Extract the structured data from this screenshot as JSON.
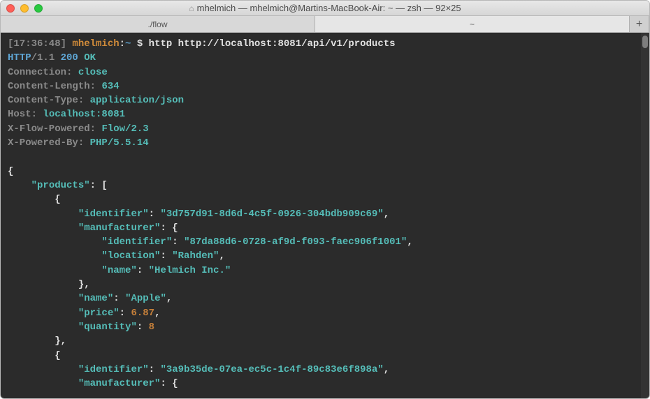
{
  "window": {
    "title": "mhelmich — mhelmich@Martins-MacBook-Air: ~ — zsh — 92×25"
  },
  "tabs": {
    "left": "./flow",
    "right": "~",
    "add": "+"
  },
  "prompt": {
    "time": "[17:36:48]",
    "user": "mhelmich",
    "sep": ":",
    "path": "~",
    "sigil": "$",
    "command": "http http://localhost:8081/api/v1/products"
  },
  "response": {
    "protocol": "HTTP",
    "slash": "/1.1",
    "status_code": "200",
    "status_text": "OK",
    "headers": {
      "connection_k": "Connection:",
      "connection_v": "close",
      "content_length_k": "Content-Length:",
      "content_length_v": "634",
      "content_type_k": "Content-Type:",
      "content_type_v": "application/json",
      "host_k": "Host:",
      "host_v": "localhost:8081",
      "x_flow_k": "X-Flow-Powered:",
      "x_flow_v": "Flow/2.3",
      "x_powered_k": "X-Powered-By:",
      "x_powered_v": "PHP/5.5.14"
    }
  },
  "json_body": {
    "open_brace": "{",
    "products_key": "\"products\"",
    "colon_bracket": ": [",
    "obj_open": "{",
    "p1_identifier_k": "\"identifier\"",
    "p1_identifier_v": "\"3d757d91-8d6d-4c5f-0926-304bdb909c69\"",
    "p1_manufacturer_k": "\"manufacturer\"",
    "m1_identifier_k": "\"identifier\"",
    "m1_identifier_v": "\"87da88d6-0728-af9d-f093-faec906f1001\"",
    "m1_location_k": "\"location\"",
    "m1_location_v": "\"Rahden\"",
    "m1_name_k": "\"name\"",
    "m1_name_v": "\"Helmich Inc.\"",
    "obj_close_comma": "},",
    "p1_name_k": "\"name\"",
    "p1_name_v": "\"Apple\"",
    "p1_price_k": "\"price\"",
    "p1_price_v": "6.87",
    "p1_quantity_k": "\"quantity\"",
    "p1_quantity_v": "8",
    "p2_identifier_k": "\"identifier\"",
    "p2_identifier_v": "\"3a9b35de-07ea-ec5c-1c4f-89c83e6f898a\"",
    "p2_manufacturer_k": "\"manufacturer\"",
    "brace_open_partial": ": {"
  }
}
